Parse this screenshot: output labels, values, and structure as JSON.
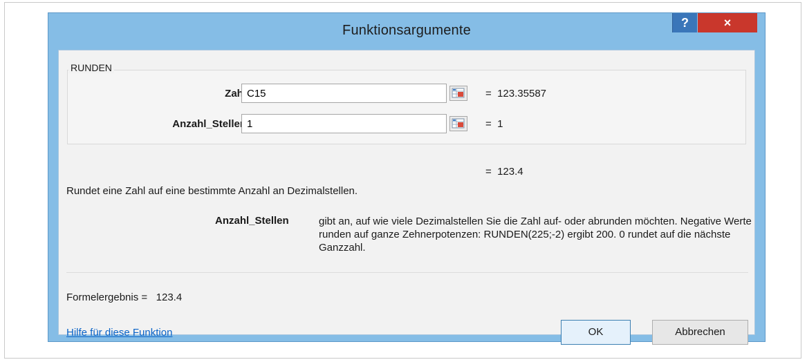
{
  "dialog": {
    "title": "Funktionsargumente",
    "help_button": "?",
    "close_button": "×"
  },
  "function": {
    "name": "RUNDEN",
    "arguments": [
      {
        "label": "Zahl",
        "value": "C15",
        "evaluated": "=  123.35587"
      },
      {
        "label": "Anzahl_Stellen",
        "value": "1",
        "evaluated": "=  1"
      }
    ],
    "result": "=  123.4",
    "description": "Rundet eine Zahl auf eine bestimmte Anzahl an Dezimalstellen.",
    "param_name": "Anzahl_Stellen",
    "param_description": "gibt an, auf wie viele Dezimalstellen Sie die Zahl auf- oder abrunden möchten. Negative Werte runden auf ganze Zehnerpotenzen: RUNDEN(225;-2) ergibt 200. 0 rundet auf die nächste Ganzzahl."
  },
  "footer": {
    "formula_result": "Formelergebnis =   123.4",
    "help_link": "Hilfe für diese Funktion",
    "ok_label": "OK",
    "cancel_label": "Abbrechen"
  },
  "colors": {
    "frame": "#85bde6",
    "close": "#c9372c",
    "help": "#3a76b9",
    "link": "#0a63c7"
  }
}
